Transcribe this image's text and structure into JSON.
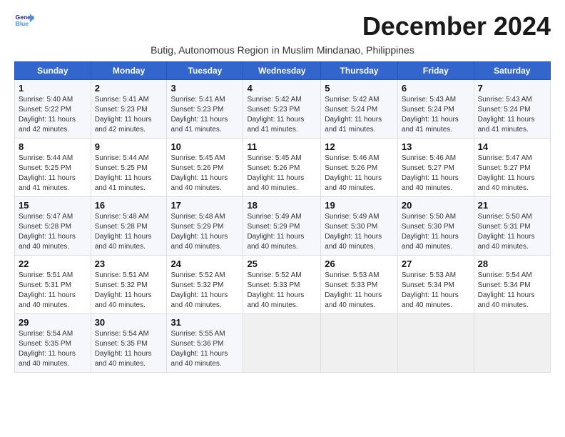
{
  "logo": {
    "line1": "General",
    "line2": "Blue"
  },
  "title": "December 2024",
  "subtitle": "Butig, Autonomous Region in Muslim Mindanao, Philippines",
  "days_of_week": [
    "Sunday",
    "Monday",
    "Tuesday",
    "Wednesday",
    "Thursday",
    "Friday",
    "Saturday"
  ],
  "weeks": [
    [
      {
        "day": "1",
        "detail": "Sunrise: 5:40 AM\nSunset: 5:22 PM\nDaylight: 11 hours\nand 42 minutes."
      },
      {
        "day": "2",
        "detail": "Sunrise: 5:41 AM\nSunset: 5:23 PM\nDaylight: 11 hours\nand 42 minutes."
      },
      {
        "day": "3",
        "detail": "Sunrise: 5:41 AM\nSunset: 5:23 PM\nDaylight: 11 hours\nand 41 minutes."
      },
      {
        "day": "4",
        "detail": "Sunrise: 5:42 AM\nSunset: 5:23 PM\nDaylight: 11 hours\nand 41 minutes."
      },
      {
        "day": "5",
        "detail": "Sunrise: 5:42 AM\nSunset: 5:24 PM\nDaylight: 11 hours\nand 41 minutes."
      },
      {
        "day": "6",
        "detail": "Sunrise: 5:43 AM\nSunset: 5:24 PM\nDaylight: 11 hours\nand 41 minutes."
      },
      {
        "day": "7",
        "detail": "Sunrise: 5:43 AM\nSunset: 5:24 PM\nDaylight: 11 hours\nand 41 minutes."
      }
    ],
    [
      {
        "day": "8",
        "detail": "Sunrise: 5:44 AM\nSunset: 5:25 PM\nDaylight: 11 hours\nand 41 minutes."
      },
      {
        "day": "9",
        "detail": "Sunrise: 5:44 AM\nSunset: 5:25 PM\nDaylight: 11 hours\nand 41 minutes."
      },
      {
        "day": "10",
        "detail": "Sunrise: 5:45 AM\nSunset: 5:26 PM\nDaylight: 11 hours\nand 40 minutes."
      },
      {
        "day": "11",
        "detail": "Sunrise: 5:45 AM\nSunset: 5:26 PM\nDaylight: 11 hours\nand 40 minutes."
      },
      {
        "day": "12",
        "detail": "Sunrise: 5:46 AM\nSunset: 5:26 PM\nDaylight: 11 hours\nand 40 minutes."
      },
      {
        "day": "13",
        "detail": "Sunrise: 5:46 AM\nSunset: 5:27 PM\nDaylight: 11 hours\nand 40 minutes."
      },
      {
        "day": "14",
        "detail": "Sunrise: 5:47 AM\nSunset: 5:27 PM\nDaylight: 11 hours\nand 40 minutes."
      }
    ],
    [
      {
        "day": "15",
        "detail": "Sunrise: 5:47 AM\nSunset: 5:28 PM\nDaylight: 11 hours\nand 40 minutes."
      },
      {
        "day": "16",
        "detail": "Sunrise: 5:48 AM\nSunset: 5:28 PM\nDaylight: 11 hours\nand 40 minutes."
      },
      {
        "day": "17",
        "detail": "Sunrise: 5:48 AM\nSunset: 5:29 PM\nDaylight: 11 hours\nand 40 minutes."
      },
      {
        "day": "18",
        "detail": "Sunrise: 5:49 AM\nSunset: 5:29 PM\nDaylight: 11 hours\nand 40 minutes."
      },
      {
        "day": "19",
        "detail": "Sunrise: 5:49 AM\nSunset: 5:30 PM\nDaylight: 11 hours\nand 40 minutes."
      },
      {
        "day": "20",
        "detail": "Sunrise: 5:50 AM\nSunset: 5:30 PM\nDaylight: 11 hours\nand 40 minutes."
      },
      {
        "day": "21",
        "detail": "Sunrise: 5:50 AM\nSunset: 5:31 PM\nDaylight: 11 hours\nand 40 minutes."
      }
    ],
    [
      {
        "day": "22",
        "detail": "Sunrise: 5:51 AM\nSunset: 5:31 PM\nDaylight: 11 hours\nand 40 minutes."
      },
      {
        "day": "23",
        "detail": "Sunrise: 5:51 AM\nSunset: 5:32 PM\nDaylight: 11 hours\nand 40 minutes."
      },
      {
        "day": "24",
        "detail": "Sunrise: 5:52 AM\nSunset: 5:32 PM\nDaylight: 11 hours\nand 40 minutes."
      },
      {
        "day": "25",
        "detail": "Sunrise: 5:52 AM\nSunset: 5:33 PM\nDaylight: 11 hours\nand 40 minutes."
      },
      {
        "day": "26",
        "detail": "Sunrise: 5:53 AM\nSunset: 5:33 PM\nDaylight: 11 hours\nand 40 minutes."
      },
      {
        "day": "27",
        "detail": "Sunrise: 5:53 AM\nSunset: 5:34 PM\nDaylight: 11 hours\nand 40 minutes."
      },
      {
        "day": "28",
        "detail": "Sunrise: 5:54 AM\nSunset: 5:34 PM\nDaylight: 11 hours\nand 40 minutes."
      }
    ],
    [
      {
        "day": "29",
        "detail": "Sunrise: 5:54 AM\nSunset: 5:35 PM\nDaylight: 11 hours\nand 40 minutes."
      },
      {
        "day": "30",
        "detail": "Sunrise: 5:54 AM\nSunset: 5:35 PM\nDaylight: 11 hours\nand 40 minutes."
      },
      {
        "day": "31",
        "detail": "Sunrise: 5:55 AM\nSunset: 5:36 PM\nDaylight: 11 hours\nand 40 minutes."
      },
      {
        "day": "",
        "detail": ""
      },
      {
        "day": "",
        "detail": ""
      },
      {
        "day": "",
        "detail": ""
      },
      {
        "day": "",
        "detail": ""
      }
    ]
  ]
}
